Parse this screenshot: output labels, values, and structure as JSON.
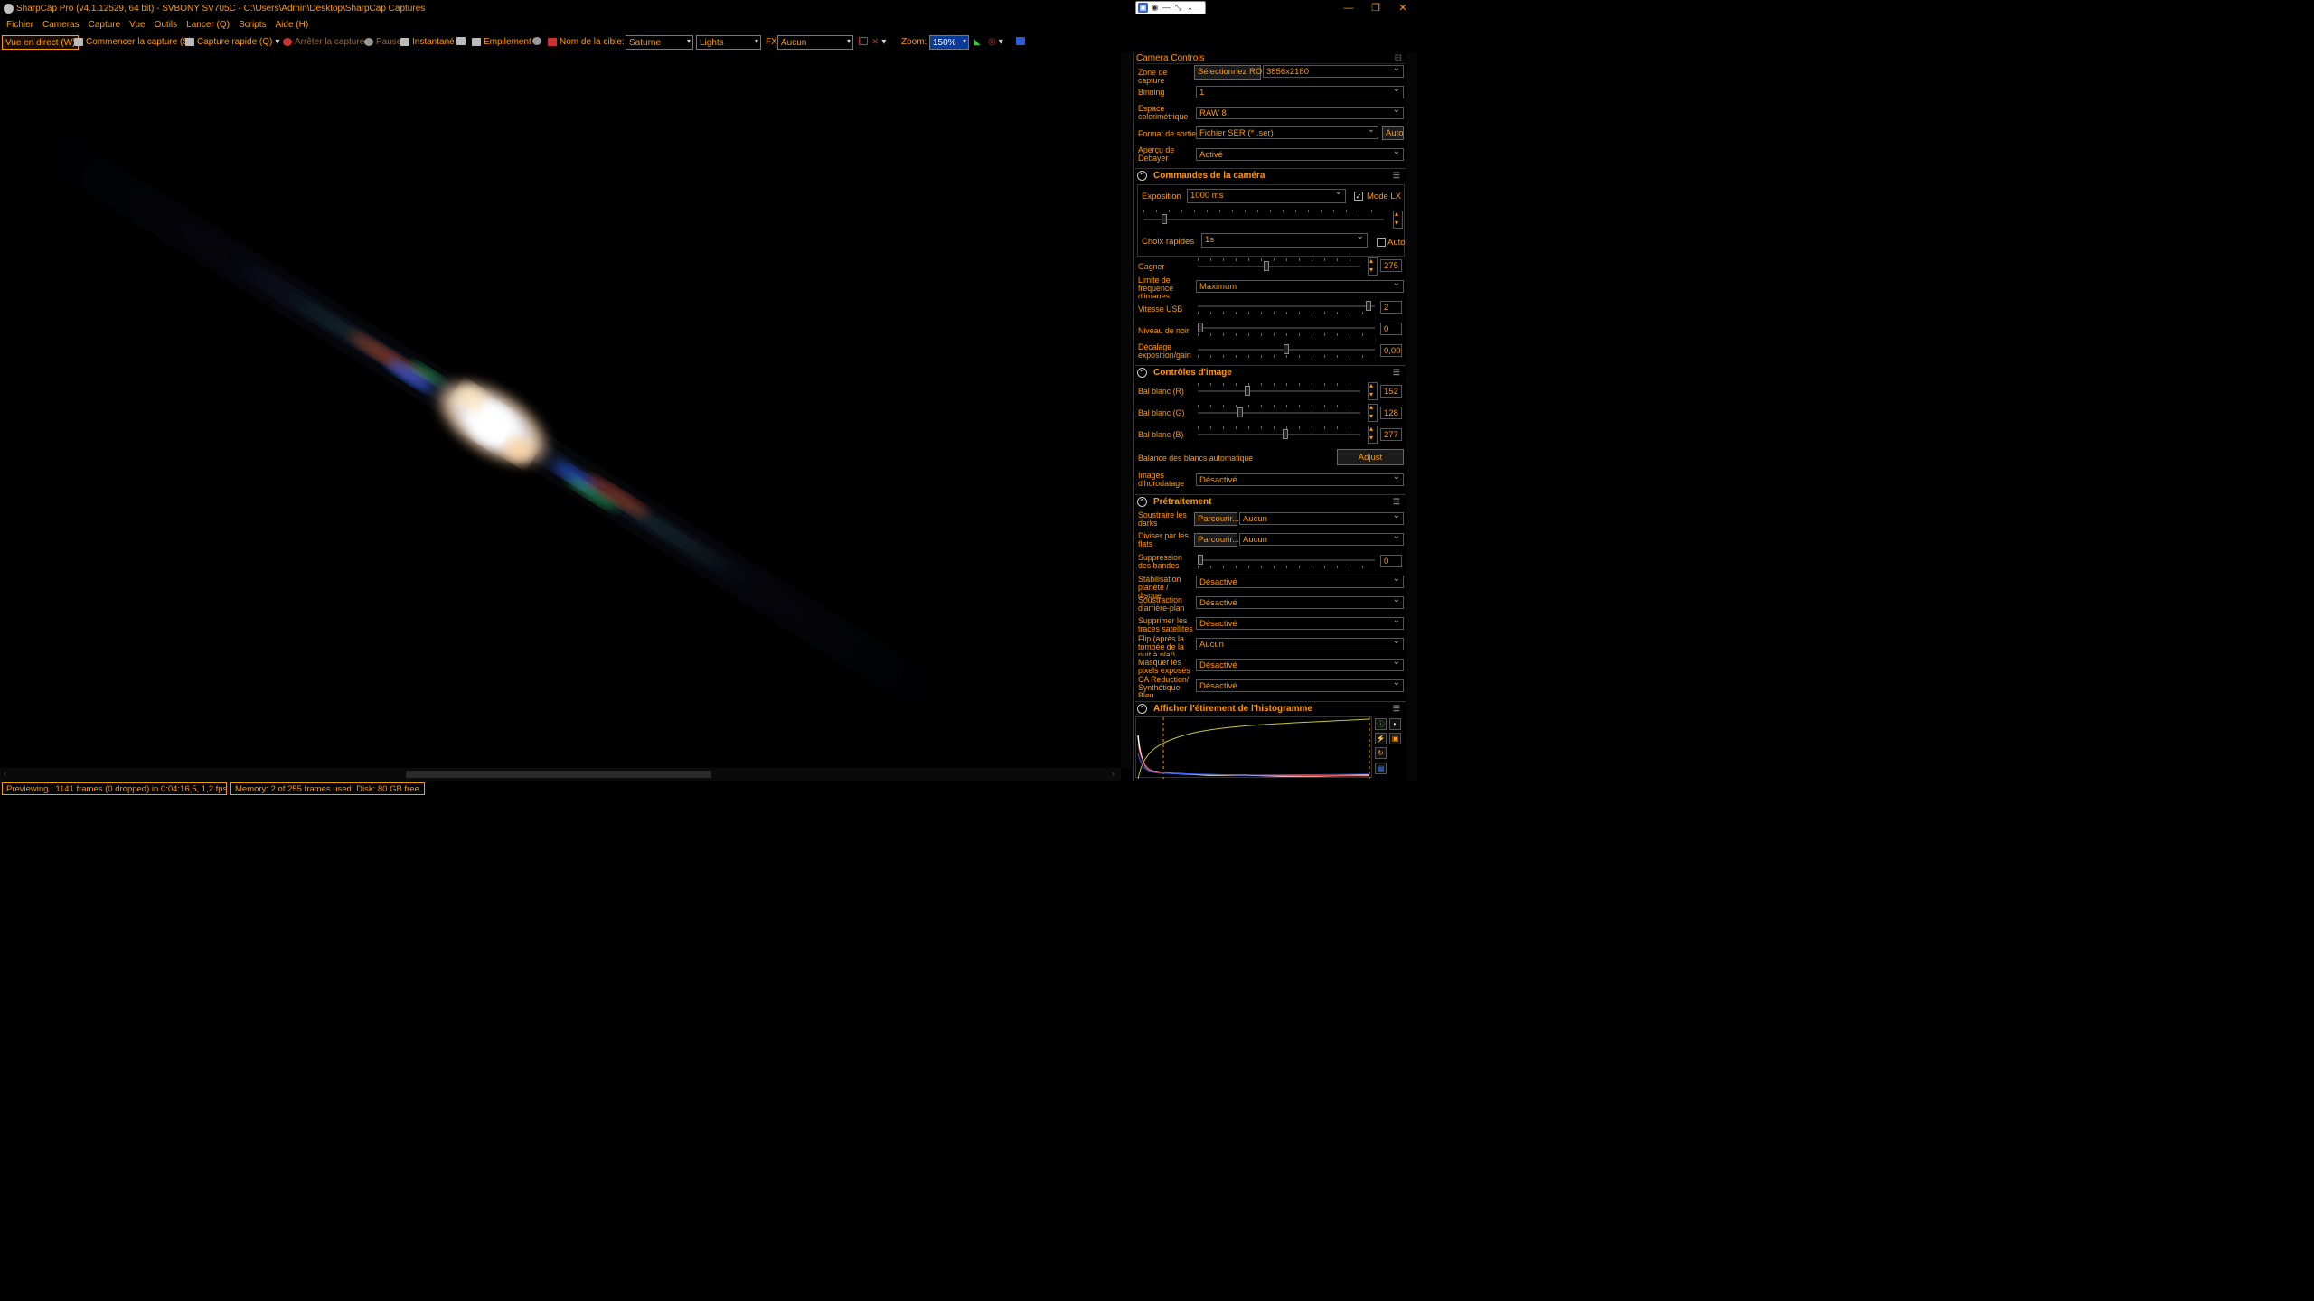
{
  "window": {
    "title": "SharpCap Pro (v4.1.12529, 64 bit) - SVBONY SV705C - C:\\Users\\Admin\\Desktop\\SharpCap Captures",
    "min": "—",
    "max": "❐",
    "close": "✕"
  },
  "menu": [
    "Fichier",
    "Cameras",
    "Capture",
    "Vue",
    "Outils",
    "Lancer (Q)",
    "Scripts",
    "Aide (H)"
  ],
  "toolbar": {
    "live": "Vue en direct (W)",
    "start": "Commencer la capture (S)",
    "quick": "Capture rapide (Q)",
    "stop": "Arrêter la capture",
    "pause": "Pause",
    "snapshot": "Instantané",
    "stacking": "Empilement",
    "target_label": "Nom de la cible:",
    "target": "Saturne",
    "frame_type": "Lights",
    "fx_label": "FX",
    "fx": "Aucun",
    "zoom_label": "Zoom:",
    "zoom": "150%"
  },
  "status": {
    "preview": "Previewing : 1141 frames (0 dropped) in 0:04:16,5, 1,2 fps",
    "memory": "Memory: 2 of 255 frames used, Disk: 80 GB free"
  },
  "panel": {
    "header": "Camera Controls",
    "capture_area": {
      "label": "Zone de capture",
      "button": "Sélectionnez ROI",
      "value": "3856x2180"
    },
    "binning": {
      "label": "Binning",
      "value": "1"
    },
    "colorspace": {
      "label": "Espace colorimétrique",
      "value": "RAW 8"
    },
    "output": {
      "label": "Format de sortie",
      "value": "Fichier SER (* .ser)",
      "button": "Auto"
    },
    "debayer": {
      "label": "Aperçu de Debayer",
      "value": "Activé"
    },
    "camera_controls": {
      "title": "Commandes de la caméra",
      "exposure_label": "Exposition",
      "exposure_value": "1000 ms",
      "lx_label": "Mode LX",
      "quick_label": "Choix rapides",
      "quick_value": "1s",
      "auto_label": "Auto",
      "gain_label": "Gagner",
      "gain_value": "275",
      "gain_pos": 0.42,
      "fps_label": "Limite de fréquence d'images",
      "fps_value": "Maximum",
      "usb_label": "Vitesse USB",
      "usb_value": "2",
      "usb_pos": 0.98,
      "black_label": "Niveau de noir",
      "black_value": "0",
      "black_pos": 0.0,
      "offset_label": "Décalage exposition/gain",
      "offset_value": "0,00",
      "offset_pos": 0.5
    },
    "image_controls": {
      "title": "Contrôles d'image",
      "wbr_label": "Bal blanc (R)",
      "wbr_value": "152",
      "wbr_pos": 0.3,
      "wbg_label": "Bal blanc (G)",
      "wbg_value": "128",
      "wbg_pos": 0.25,
      "wbb_label": "Bal blanc (B)",
      "wbb_value": "277",
      "wbb_pos": 0.54,
      "auto_wb_label": "Balance des blancs automatique",
      "adjust": "Adjust",
      "timestamp_label": "Images d'horodatage",
      "timestamp_value": "Désactivé"
    },
    "preprocessing": {
      "title": "Prétraitement",
      "darks_label": "Soustraire les darks",
      "darks_button": "Parcourir...",
      "darks_value": "Aucun",
      "flats_label": "Diviser par les flats",
      "flats_button": "Parcourir...",
      "flats_value": "Aucun",
      "banding_label": "Suppression des bandes",
      "banding_value": "0",
      "stab_label": "Stabilisation planète / disque",
      "stab_value": "Désactivé",
      "bg_label": "Soustraction d'arrière-plan",
      "bg_value": "Désactivé",
      "sat_label": "Supprimer les traces satellites",
      "sat_value": "Désactivé",
      "flip_label": "Flip (après la tombée de la nuit à plat)",
      "flip_value": "Aucun",
      "mask_label": "Masquer les pixels exposés",
      "mask_value": "Désactivé",
      "ca_label": "CA Reduction/ Synthétique Bleu",
      "ca_value": "Désactivé"
    },
    "histogram": {
      "title": "Afficher l'étirement de l'histogramme"
    }
  }
}
